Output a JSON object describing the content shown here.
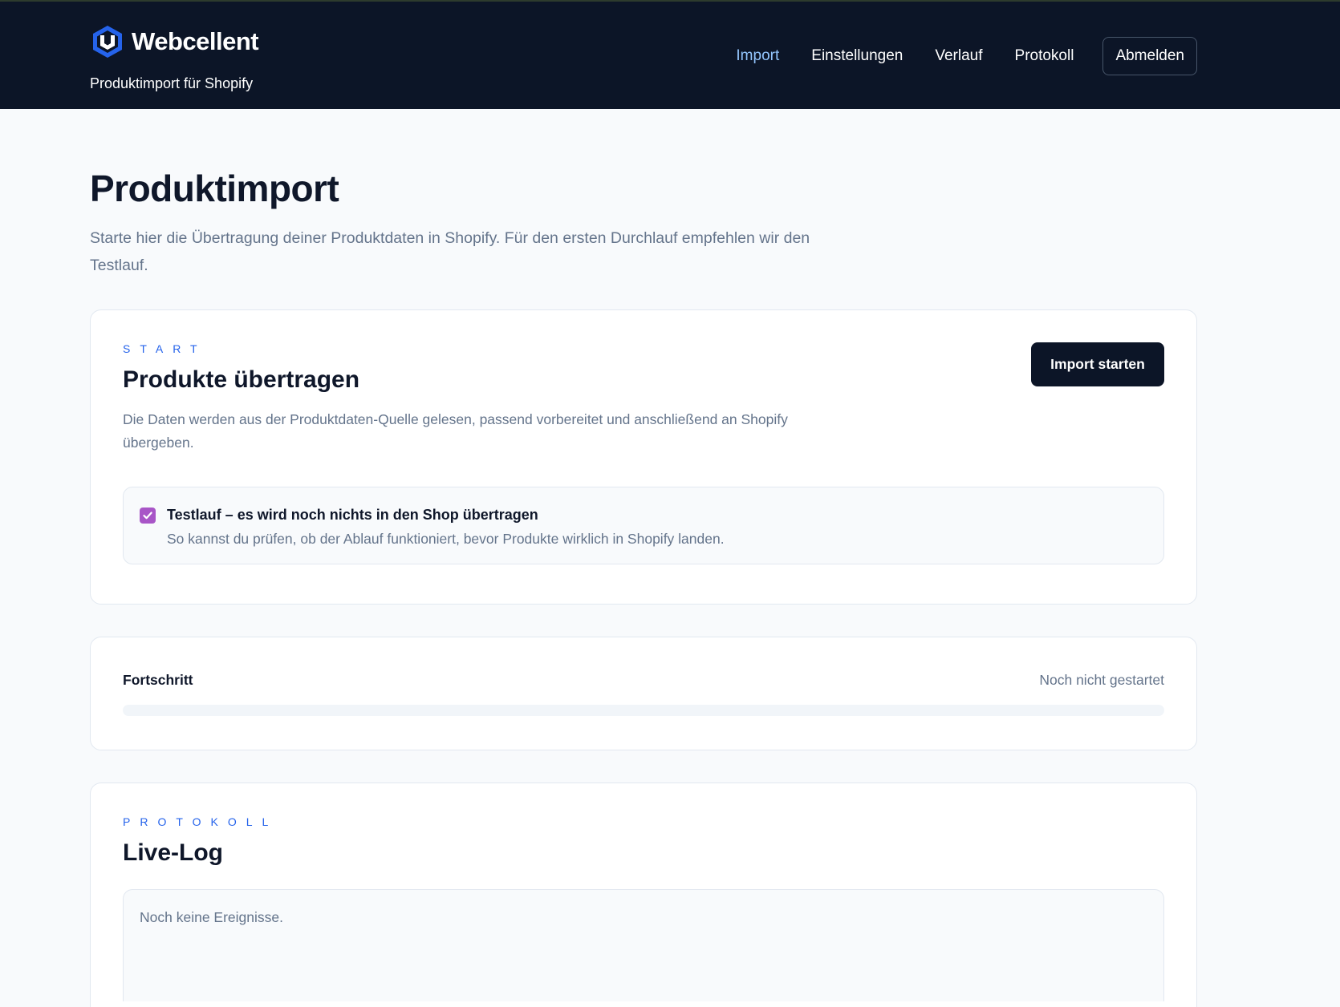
{
  "header": {
    "brand_name": "Webcellent",
    "brand_subtitle": "Produktimport für Shopify",
    "nav": [
      {
        "label": "Import",
        "active": true
      },
      {
        "label": "Einstellungen",
        "active": false
      },
      {
        "label": "Verlauf",
        "active": false
      },
      {
        "label": "Protokoll",
        "active": false
      }
    ],
    "logout_label": "Abmelden"
  },
  "page": {
    "title": "Produktimport",
    "description": "Starte hier die Übertragung deiner Produktdaten in Shopify. Für den ersten Durchlauf empfehlen wir den Testlauf."
  },
  "start_card": {
    "eyebrow": "START",
    "title": "Produkte übertragen",
    "description": "Die Daten werden aus der Produktdaten-Quelle gelesen, passend vorbereitet und anschließend an Shopify übergeben.",
    "button_label": "Import starten",
    "testrun": {
      "checked": true,
      "label": "Testlauf – es wird noch nichts in den Shop übertragen",
      "hint": "So kannst du prüfen, ob der Ablauf funktioniert, bevor Produkte wirklich in Shopify landen."
    }
  },
  "progress_card": {
    "label": "Fortschritt",
    "status": "Noch nicht gestartet",
    "percent": 0
  },
  "log_card": {
    "eyebrow": "PROTOKOLL",
    "title": "Live-Log",
    "empty_text": "Noch keine Ereignisse."
  },
  "colors": {
    "header_bg": "#0c1527",
    "accent": "#2563eb",
    "nav_active": "#93c5fd",
    "checkbox": "#a855c7"
  },
  "icons": {
    "brand_logo": "hexagon-logo-icon",
    "checkbox": "checkmark-icon"
  }
}
